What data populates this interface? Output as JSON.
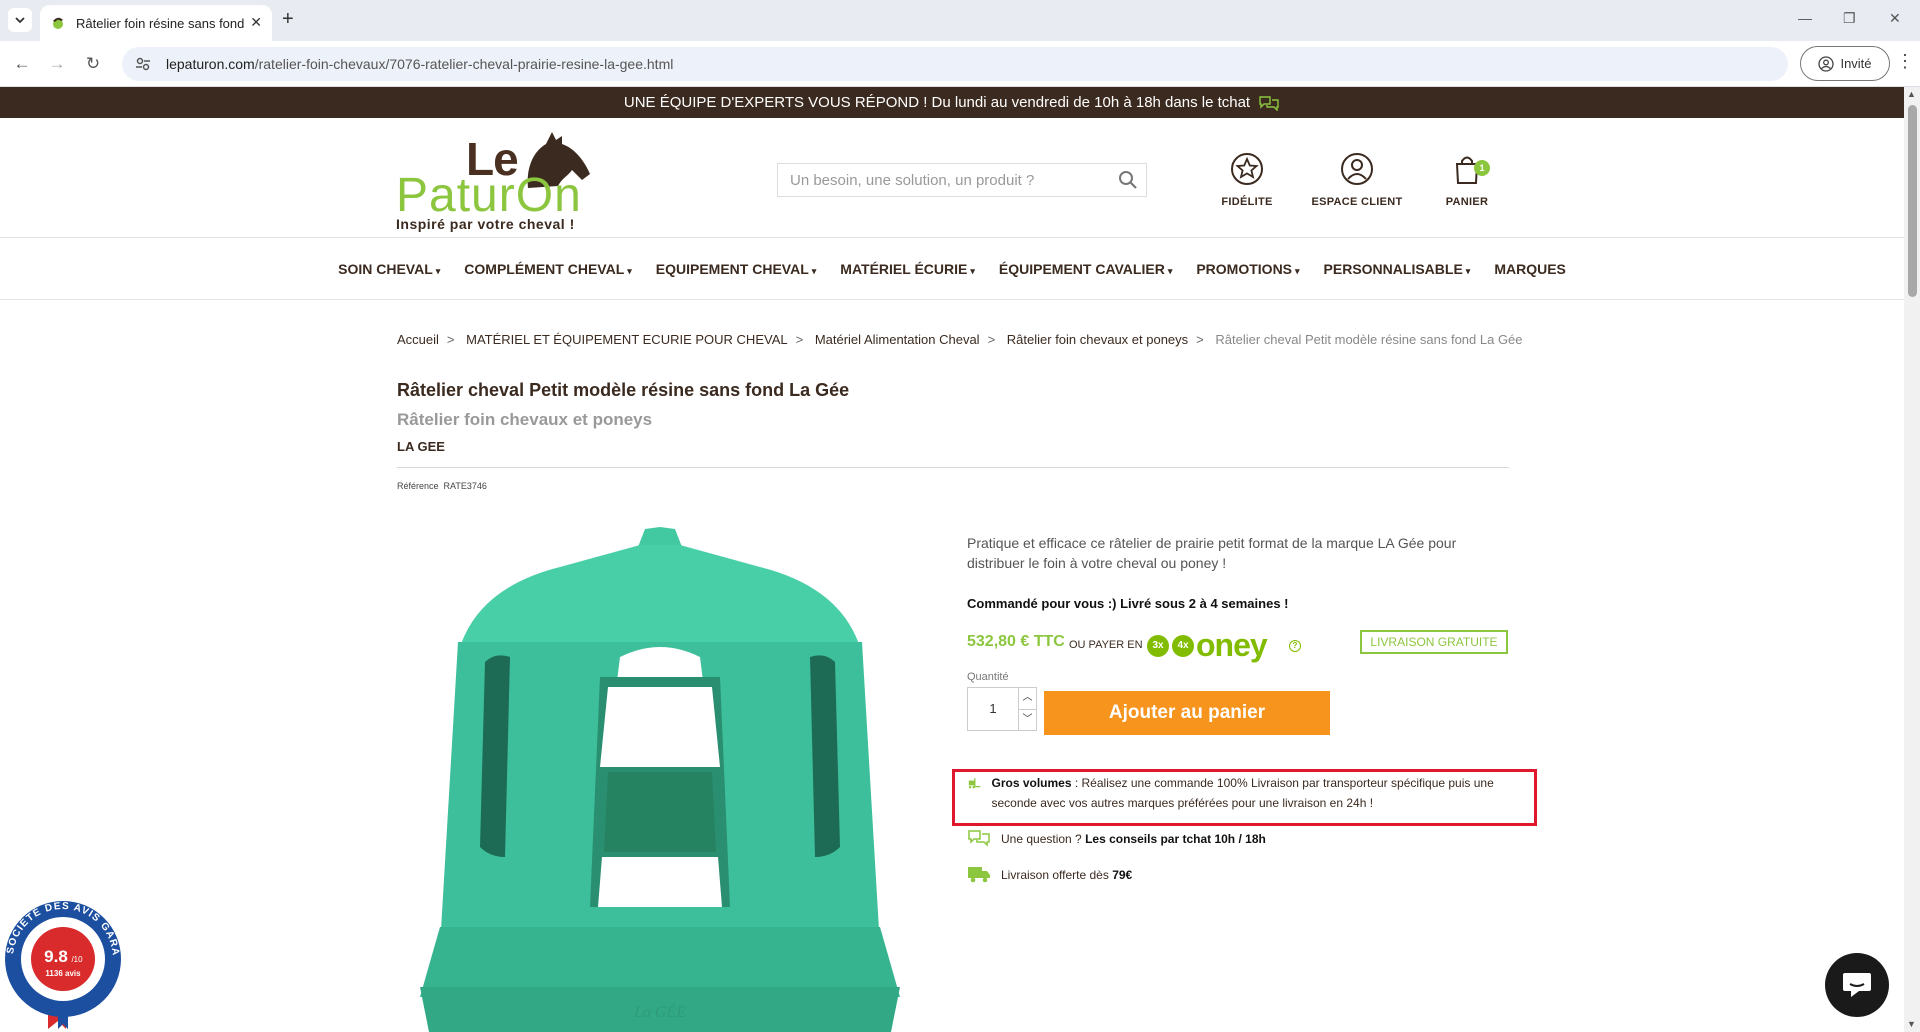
{
  "browser": {
    "tab_title": "Râtelier foin résine sans fond p",
    "url_domain": "lepaturon.com",
    "url_path": "/ratelier-foin-chevaux/7076-ratelier-cheval-prairie-resine-la-gee.html",
    "guest_label": "Invité"
  },
  "promo_bar": {
    "text": "UNE ÉQUIPE D'EXPERTS VOUS RÉPOND ! Du lundi au vendredi de 10h à 18h dans le tchat"
  },
  "logo": {
    "le": "Le",
    "paturon": "PaturOn",
    "tagline": "Inspiré par votre cheval !"
  },
  "search": {
    "placeholder": "Un besoin, une solution, un produit ?"
  },
  "header_icons": {
    "fidelite": "FIDÉLITE",
    "espace_client": "ESPACE CLIENT",
    "panier": "PANIER",
    "cart_count": "1"
  },
  "nav": [
    {
      "label": "SOIN CHEVAL",
      "dropdown": true
    },
    {
      "label": "COMPLÉMENT CHEVAL",
      "dropdown": true
    },
    {
      "label": "EQUIPEMENT CHEVAL",
      "dropdown": true
    },
    {
      "label": "MATÉRIEL ÉCURIE",
      "dropdown": true
    },
    {
      "label": "ÉQUIPEMENT CAVALIER",
      "dropdown": true
    },
    {
      "label": "PROMOTIONS",
      "dropdown": true
    },
    {
      "label": "PERSONNALISABLE",
      "dropdown": true
    },
    {
      "label": "MARQUES",
      "dropdown": false
    }
  ],
  "breadcrumb": {
    "items": [
      "Accueil",
      "MATÉRIEL ET ÉQUIPEMENT ECURIE POUR CHEVAL",
      "Matériel Alimentation Cheval",
      "Râtelier foin chevaux et poneys"
    ],
    "current": "Râtelier cheval Petit modèle résine sans fond La Gée"
  },
  "product": {
    "title": "Râtelier cheval Petit modèle résine sans fond La Gée",
    "category": "Râtelier foin chevaux et poneys",
    "brand": "LA GEE",
    "reference_label": "Référence",
    "reference": "RATE3746",
    "description": "Pratique et efficace ce râtelier de prairie petit format de la marque LA Gée pour distribuer le foin à votre cheval ou poney !",
    "delivery_note": "Commandé pour vous :) Livré sous 2 à 4 semaines !",
    "price": "532,80 € TTC",
    "pay_in_label": "OU PAYER EN",
    "oney_3x": "3x",
    "oney_4x": "4x",
    "oney_logo": "oney",
    "free_delivery": "LIVRAISON GRATUITE",
    "quantity_label": "Quantité",
    "quantity": "1",
    "add_to_cart": "Ajouter au panier",
    "image_mark": "La GÉE"
  },
  "info": {
    "volumes_title": "Gros volumes",
    "volumes_text": " : Réalisez une commande 100% Livraison par transporteur spécifique puis une seconde avec vos autres marques préférées pour une livraison en 24h !",
    "question_prefix": "Une question ?",
    "question_bold": "Les conseils par tchat 10h / 18h",
    "shipping_prefix": "Livraison offerte dès",
    "shipping_bold": "79€"
  },
  "reviews_badge": {
    "ring_text": "SOCIÉTÉ DES AVIS GARANTIS",
    "score": "9.8",
    "score_suffix": "/10",
    "count": "1136 avis"
  },
  "colors": {
    "brand_green": "#8cc63f",
    "brand_brown": "#3b2a1f",
    "cta_orange": "#f7941d",
    "highlight_red": "#e0182d",
    "product_teal": "#3cbf9a"
  }
}
